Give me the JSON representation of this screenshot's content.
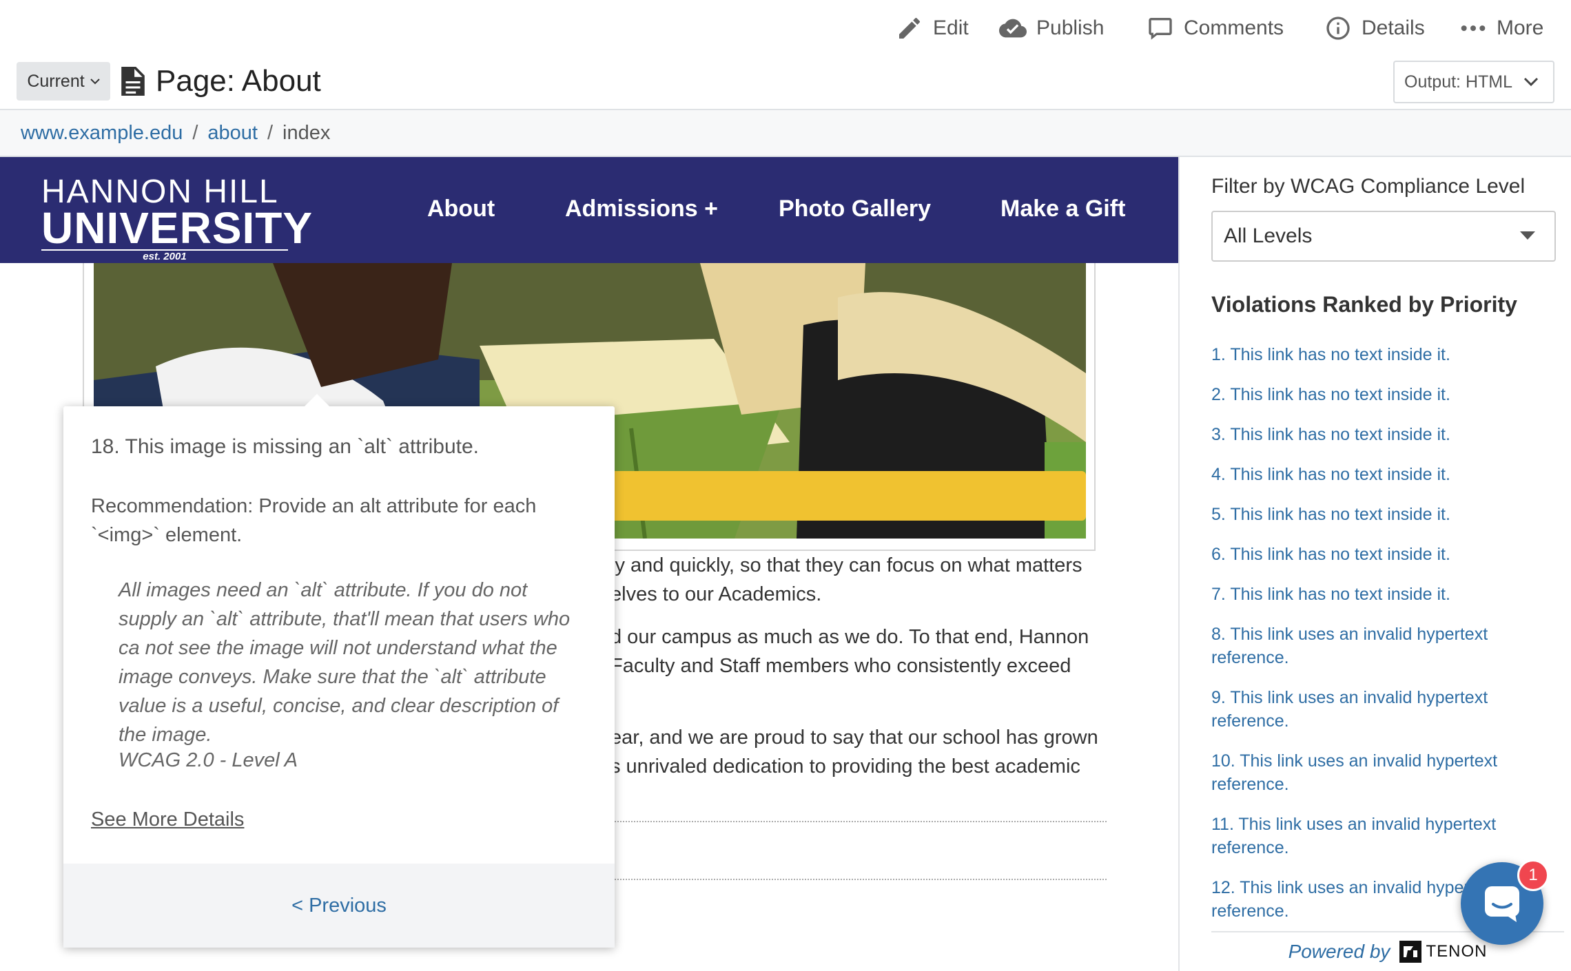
{
  "toolbar": {
    "edit": "Edit",
    "publish": "Publish",
    "comments": "Comments",
    "details": "Details",
    "more": "More"
  },
  "header": {
    "version_label": "Current",
    "page_title": "Page: About",
    "output_label": "Output: HTML"
  },
  "breadcrumb": {
    "site": "www.example.edu",
    "folder": "about",
    "current": "index",
    "separator": "/"
  },
  "site": {
    "logo_line1": "HANNON HILL",
    "logo_line2": "UNIVERSITY",
    "logo_line3": "est. 2001",
    "nav": [
      "About",
      "Admissions +",
      "Photo Gallery",
      "Make a Gift"
    ],
    "nav_bg": "#2b2c72",
    "body_lines": [
      "ly and quickly, so that they can focus on what matters",
      "elves to our Academics.",
      "d our campus as much as we do. To that end, Hannon",
      " Faculty and Staff members who consistently exceed",
      "ear, and we are proud to say that our school has grown",
      "s unrivaled dedication to providing the best academic"
    ]
  },
  "popover": {
    "title": "18. This image is missing an `alt` attribute.",
    "recommendation": "Recommendation: Provide an alt attribute for each `<img>` element.",
    "description": "All images need an `alt` attribute. If you do not supply an `alt` attribute, that'll mean that users who ca not see the image will not understand what the image conveys. Make sure that the `alt` attribute value is a useful, concise, and clear description of the image.",
    "level": "WCAG 2.0 - Level A",
    "more_link": "See More Details",
    "previous": "< Previous"
  },
  "panel": {
    "filter_label": "Filter by WCAG Compliance Level",
    "filter_value": "All Levels",
    "heading": "Violations Ranked by Priority",
    "violations": [
      "1. This link has no text inside it.",
      "2. This link has no text inside it.",
      "3. This link has no text inside it.",
      "4. This link has no text inside it.",
      "5. This link has no text inside it.",
      "6. This link has no text inside it.",
      "7. This link has no text inside it.",
      "8. This link uses an invalid hypertext reference.",
      "9. This link uses an invalid hypertext reference.",
      "10. This link uses an invalid hypertext reference.",
      "11. This link uses an invalid hypertext reference.",
      "12. This link uses an invalid hypertext reference."
    ],
    "powered_by": "Powered by",
    "brand": "TENON"
  },
  "chat": {
    "badge_count": "1",
    "color": "#3474b4"
  },
  "colors": {
    "link": "#2e6da4",
    "accent_yellow": "#f0c230",
    "badge": "#f0464f"
  }
}
